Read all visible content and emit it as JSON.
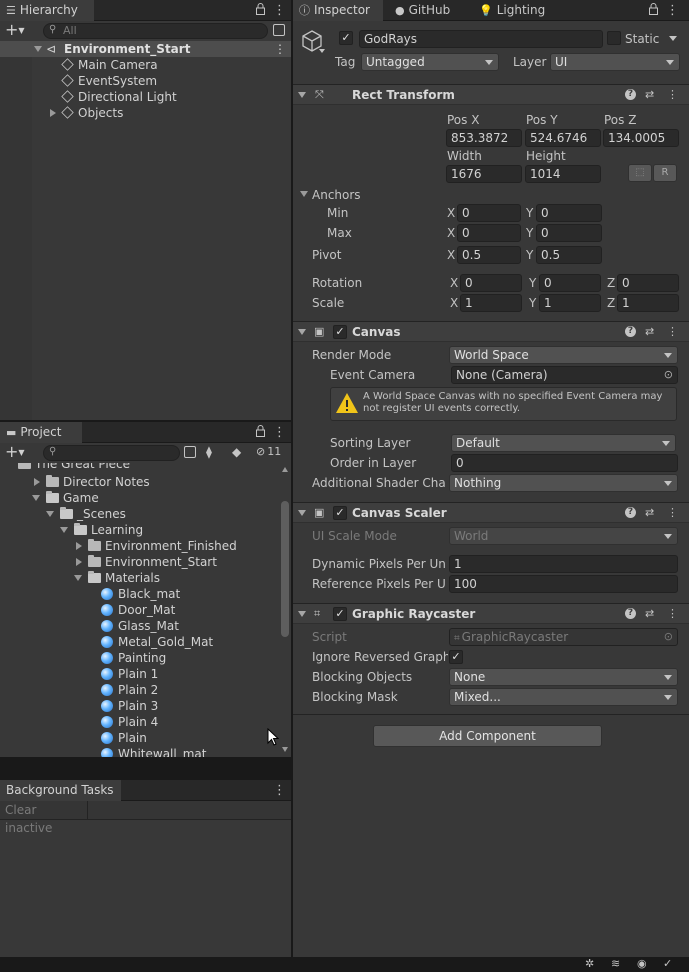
{
  "hierarchy": {
    "tab_label": "Hierarchy",
    "search_placeholder": "All",
    "scene_name": "Environment_Start",
    "items": [
      "Main Camera",
      "EventSystem",
      "Directional Light",
      "Objects"
    ]
  },
  "project": {
    "tab_label": "Project",
    "hidden_count": "11",
    "tree": {
      "great_piece": "The Great Piece",
      "director_notes": "Director Notes",
      "game": "Game",
      "scenes": "_Scenes",
      "learning": "Learning",
      "env_finished": "Environment_Finished",
      "env_start": "Environment_Start",
      "materials": "Materials"
    },
    "materials": [
      "Black_mat",
      "Door_Mat",
      "Glass_Mat",
      "Metal_Gold_Mat",
      "Painting",
      "Plain 1",
      "Plain 2",
      "Plain 3",
      "Plain 4",
      "Plain",
      "Whitewall_mat"
    ]
  },
  "background_tasks": {
    "tab_label": "Background Tasks",
    "clear_label": "Clear inactive"
  },
  "inspector": {
    "tabs": [
      "Inspector",
      "GitHub",
      "Lighting"
    ],
    "object_name": "GodRays",
    "static_label": "Static",
    "tag_label": "Tag",
    "tag_value": "Untagged",
    "layer_label": "Layer",
    "layer_value": "UI",
    "rect_transform": {
      "title": "Rect Transform",
      "pos_x_label": "Pos X",
      "pos_y_label": "Pos Y",
      "pos_z_label": "Pos Z",
      "pos_x": "853.3872",
      "pos_y": "524.6746",
      "pos_z": "134.0005",
      "width_label": "Width",
      "height_label": "Height",
      "width": "1676",
      "height": "1014",
      "r_button": "R",
      "anchors_label": "Anchors",
      "min_label": "Min",
      "max_label": "Max",
      "min_x": "0",
      "min_y": "0",
      "max_x": "0",
      "max_y": "0",
      "pivot_label": "Pivot",
      "pivot_x": "0.5",
      "pivot_y": "0.5",
      "rotation_label": "Rotation",
      "rot_x": "0",
      "rot_y": "0",
      "rot_z": "0",
      "scale_label": "Scale",
      "scale_x": "1",
      "scale_y": "1",
      "scale_z": "1",
      "axis_x": "X",
      "axis_y": "Y",
      "axis_z": "Z"
    },
    "canvas": {
      "title": "Canvas",
      "render_mode_label": "Render Mode",
      "render_mode": "World Space",
      "event_camera_label": "Event Camera",
      "event_camera": "None (Camera)",
      "warning": "A World Space Canvas with no specified Event Camera may not register UI events correctly.",
      "sorting_layer_label": "Sorting Layer",
      "sorting_layer": "Default",
      "order_label": "Order in Layer",
      "order": "0",
      "shader_label": "Additional Shader Chann",
      "shader": "Nothing"
    },
    "canvas_scaler": {
      "title": "Canvas Scaler",
      "scale_mode_label": "UI Scale Mode",
      "scale_mode": "World",
      "dynamic_label": "Dynamic Pixels Per Unit",
      "dynamic": "1",
      "reference_label": "Reference Pixels Per Un",
      "reference": "100"
    },
    "graphic_raycaster": {
      "title": "Graphic Raycaster",
      "script_label": "Script",
      "script": "GraphicRaycaster",
      "ignore_label": "Ignore Reversed Graphic",
      "blocking_objects_label": "Blocking Objects",
      "blocking_objects": "None",
      "blocking_mask_label": "Blocking Mask",
      "blocking_mask": "Mixed..."
    },
    "add_component": "Add Component"
  }
}
